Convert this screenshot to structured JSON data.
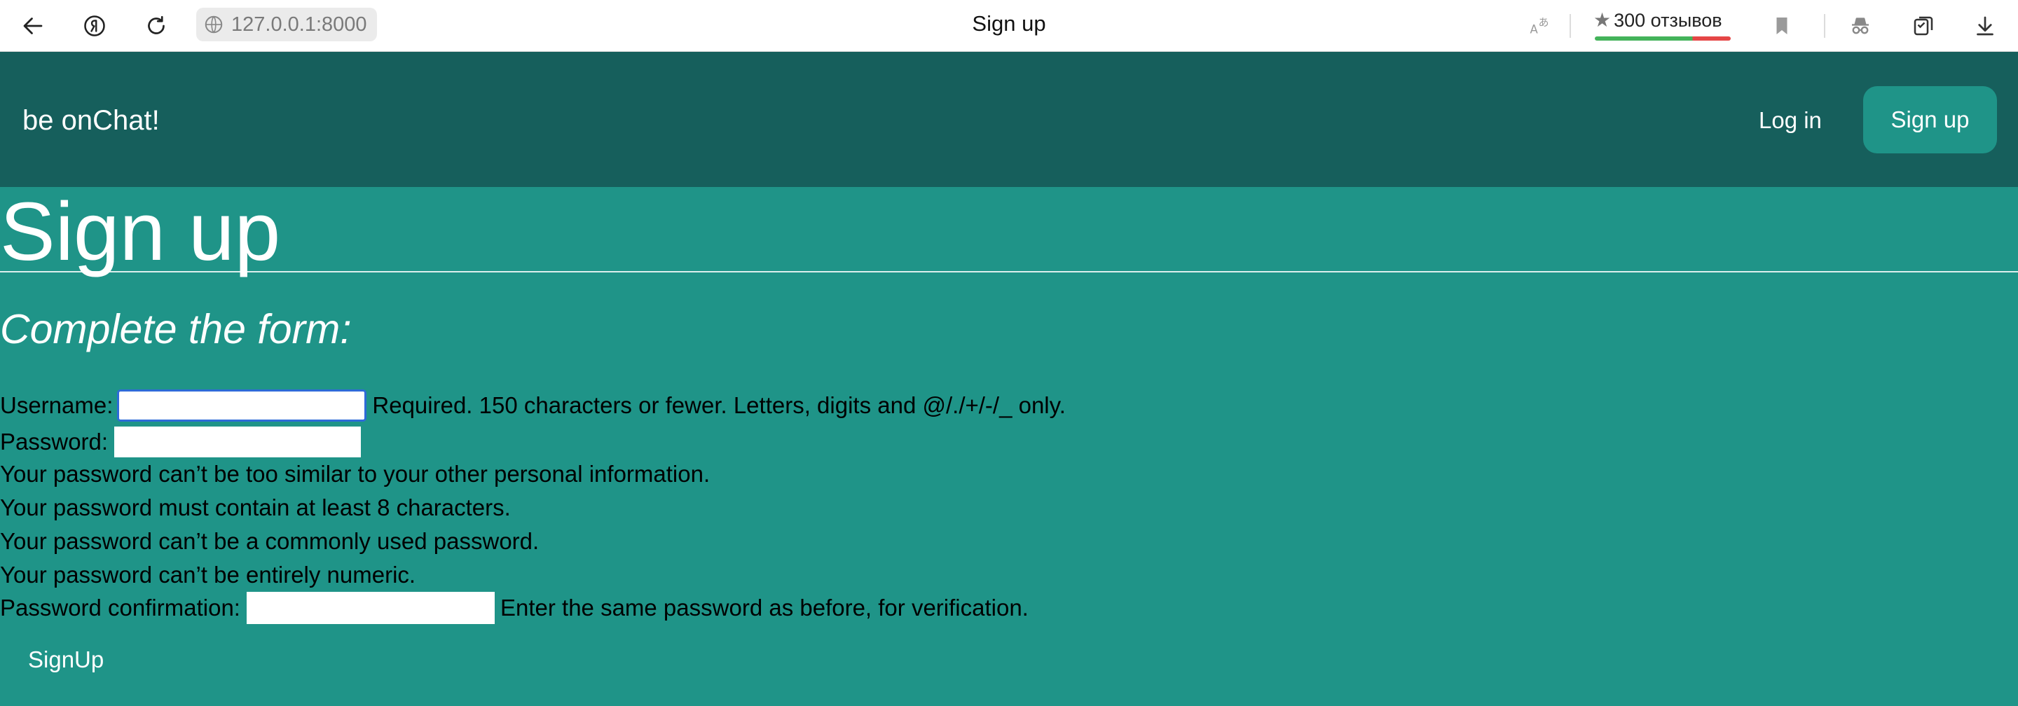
{
  "browser": {
    "url": "127.0.0.1:8000",
    "tab_title": "Sign up",
    "reviews_label": "300 отзывов",
    "reviews_star": "★",
    "icons": [
      "back-arrow-icon",
      "yandex-icon",
      "reload-icon",
      "site-info-icon",
      "translate-icon",
      "bookmark-icon",
      "incognito-icon",
      "tabs-icon",
      "download-icon"
    ]
  },
  "nav": {
    "brand": "be onChat!",
    "login_label": "Log in",
    "signup_label": "Sign up"
  },
  "page": {
    "title": "Sign up",
    "form_heading": "Complete the form:"
  },
  "form": {
    "username_label": "Username:",
    "username_value": "",
    "username_help": "Required. 150 characters or fewer. Letters, digits and @/./+/-/_ only.",
    "password_label": "Password:",
    "password_value": "",
    "password_help": [
      "Your password can’t be too similar to your other personal information.",
      "Your password must contain at least 8 characters.",
      "Your password can’t be a commonly used password.",
      "Your password can’t be entirely numeric."
    ],
    "confirm_label": "Password confirmation:",
    "confirm_value": "",
    "confirm_help": "Enter the same password as before, for verification.",
    "submit_label": "SignUp"
  },
  "colors": {
    "nav_bg": "#165f5c",
    "page_bg": "#1f9488",
    "focus_ring": "#2e6bd8"
  }
}
